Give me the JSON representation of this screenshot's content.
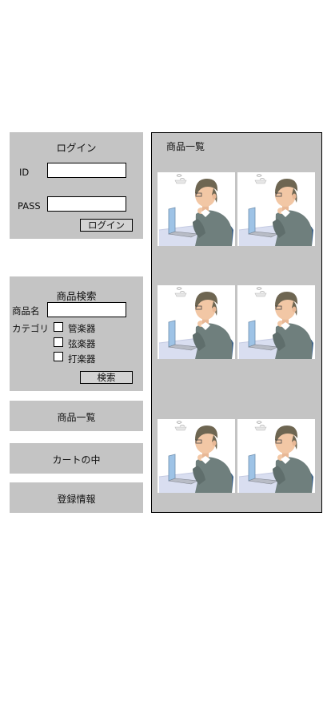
{
  "login": {
    "title": "ログイン",
    "id_label": "ID",
    "pass_label": "PASS",
    "id_value": "",
    "pass_value": "",
    "button_label": "ログイン"
  },
  "search": {
    "title": "商品検索",
    "name_label": "商品名",
    "name_value": "",
    "category_label": "カテゴリ",
    "categories": [
      {
        "label": "管楽器",
        "checked": false
      },
      {
        "label": "弦楽器",
        "checked": false
      },
      {
        "label": "打楽器",
        "checked": false
      }
    ],
    "button_label": "検索"
  },
  "nav": {
    "items": [
      {
        "label": "商品一覧"
      },
      {
        "label": "カートの中"
      },
      {
        "label": "登録情報"
      }
    ]
  },
  "products": {
    "title": "商品一覧",
    "image_icon": "thinking-man-at-laptop-illustration",
    "rows": [
      {
        "items": [
          {
            "image": "product-image"
          },
          {
            "image": "product-image"
          }
        ]
      },
      {
        "items": [
          {
            "image": "product-image"
          },
          {
            "image": "product-image"
          }
        ]
      },
      {
        "items": [
          {
            "image": "product-image"
          },
          {
            "image": "product-image"
          }
        ]
      }
    ]
  },
  "colors": {
    "panel_bg": "#c4c4c4",
    "button_bg": "#d3d3d3",
    "border": "#000000",
    "illustration_suit": "#6f7f7d",
    "illustration_hair": "#6e6652",
    "illustration_skin": "#f2c7a5",
    "illustration_desk": "#d9def0",
    "illustration_laptop": "#9ec3e6",
    "illustration_chair": "#3d6187"
  }
}
